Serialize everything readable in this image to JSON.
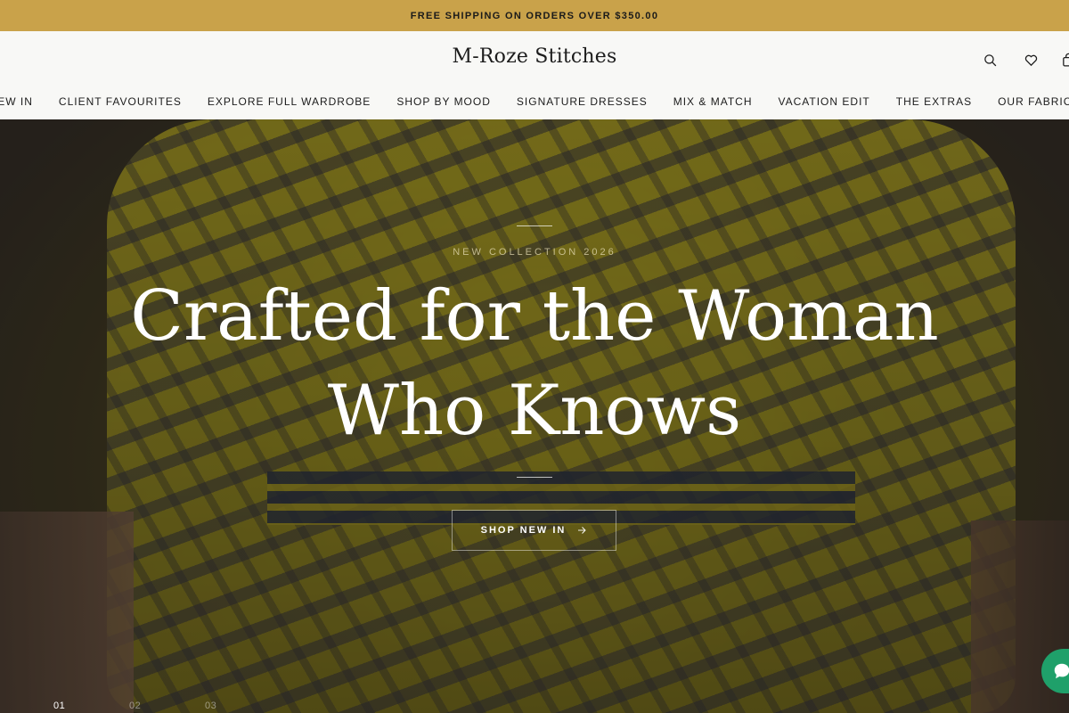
{
  "announcement": {
    "text": "FREE SHIPPING ON ORDERS OVER $350.00"
  },
  "header": {
    "brand": "M-Roze Stitches",
    "icons": [
      "search-icon",
      "heart-icon",
      "cart-icon"
    ]
  },
  "nav": {
    "items": [
      "NEW IN",
      "CLIENT FAVOURITES",
      "EXPLORE FULL WARDROBE",
      "SHOP BY MOOD",
      "SIGNATURE DRESSES",
      "MIX & MATCH",
      "VACATION EDIT",
      "THE EXTRAS",
      "OUR FABRICS"
    ]
  },
  "hero": {
    "kicker": "NEW COLLECTION 2026",
    "headline_line1": "Crafted for the Woman",
    "headline_line2": "Who Knows",
    "cta_label": "SHOP NEW IN",
    "slides": [
      "01",
      "02",
      "03"
    ],
    "active_slide": "01"
  },
  "colors": {
    "announcement_bg": "#c9a24a",
    "header_bg": "#f8f8f6",
    "chat_bubble": "#1fa06a"
  }
}
